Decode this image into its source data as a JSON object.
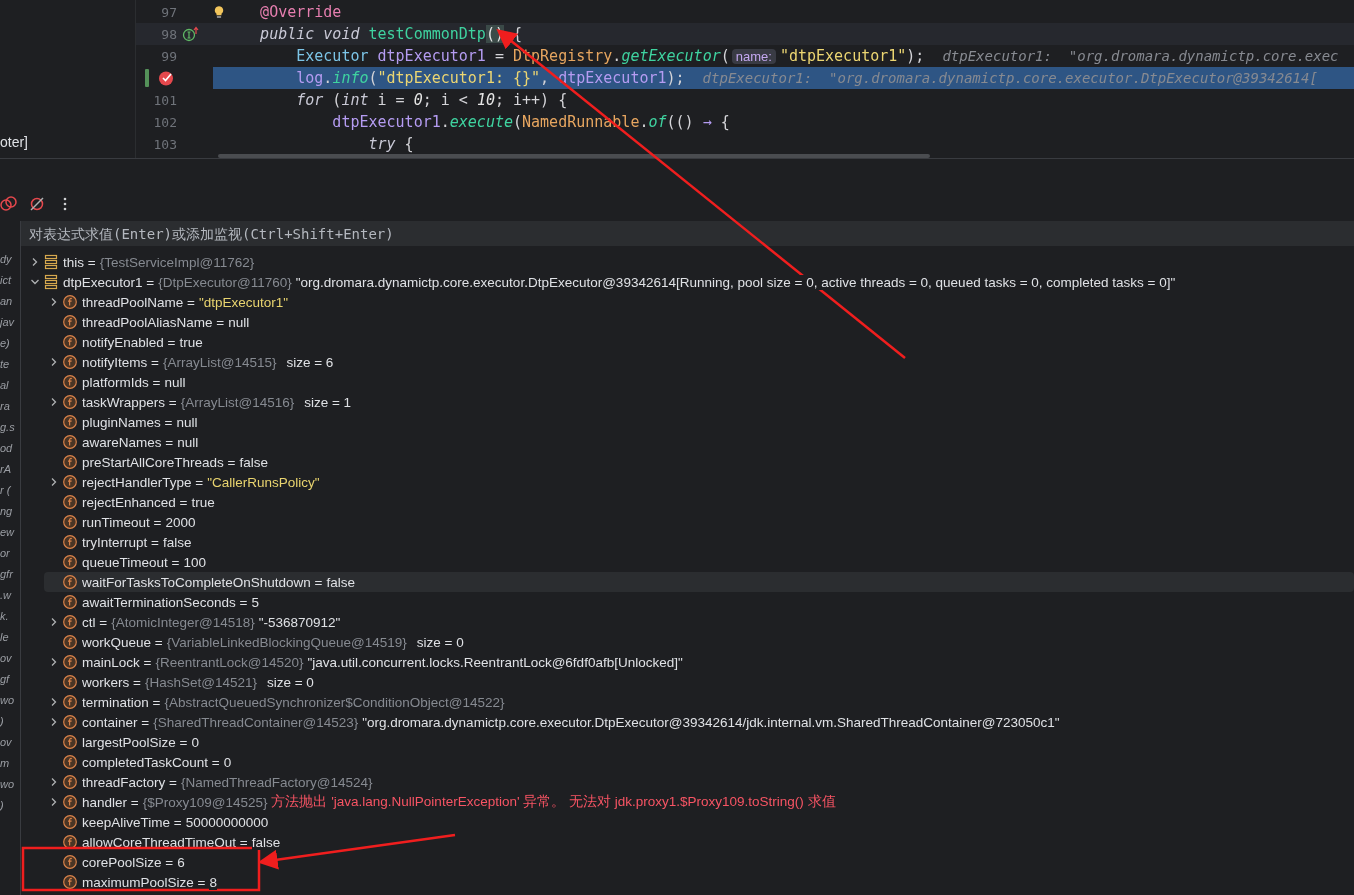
{
  "project_panel": {
    "text": "oter]"
  },
  "editor": {
    "lines": [
      {
        "number": "97",
        "current": false,
        "selected": false,
        "bulb": true,
        "tokens": [
          {
            "text": "    @Override",
            "kind": "ann"
          }
        ]
      },
      {
        "number": "98",
        "current": true,
        "selected": false,
        "implements_marker": true,
        "tokens": [
          {
            "text": "    public void ",
            "kind": "kw"
          },
          {
            "text": "testCommonDtp",
            "kind": "decl"
          },
          {
            "text": "()",
            "kind": "brace"
          },
          {
            "text": " {",
            "kind": "plain"
          }
        ]
      },
      {
        "number": "99",
        "current": false,
        "selected": false,
        "tokens": [
          {
            "text": "        Executor ",
            "kind": "type"
          },
          {
            "text": "dtpExecutor1",
            "kind": "var"
          },
          {
            "text": " = ",
            "kind": "plain"
          },
          {
            "text": "DtpRegistry",
            "kind": "cls"
          },
          {
            "text": ".",
            "kind": "plain"
          },
          {
            "text": "getExecutor",
            "kind": "call"
          },
          {
            "text": "(",
            "kind": "plain"
          },
          {
            "text": "name:",
            "kind": "hint"
          },
          {
            "text": "\"dtpExecutor1\"",
            "kind": "str"
          },
          {
            "text": ");",
            "kind": "plain"
          },
          {
            "text": "dtpExecutor1:  \"org.dromara.dynamictp.core.exec",
            "kind": "inline"
          }
        ]
      },
      {
        "current": false,
        "selected": true,
        "breakpoint": true,
        "changed": true,
        "tokens": [
          {
            "text": "        log",
            "kind": "var"
          },
          {
            "text": ".",
            "kind": "plain"
          },
          {
            "text": "info",
            "kind": "call"
          },
          {
            "text": "(",
            "kind": "plain"
          },
          {
            "text": "\"dtpExecutor1: {}\"",
            "kind": "str"
          },
          {
            "text": ", ",
            "kind": "plain"
          },
          {
            "text": "dtpExecutor1",
            "kind": "var"
          },
          {
            "text": ");",
            "kind": "plain"
          },
          {
            "text": "dtpExecutor1:  \"org.dromara.dynamictp.core.executor.DtpExecutor@39342614[",
            "kind": "inline"
          }
        ]
      },
      {
        "number": "101",
        "current": false,
        "selected": false,
        "tokens": [
          {
            "text": "        for",
            "kind": "kw"
          },
          {
            "text": " (",
            "kind": "plain"
          },
          {
            "text": "int",
            "kind": "kw"
          },
          {
            "text": " i = ",
            "kind": "plain"
          },
          {
            "text": "0",
            "kind": "num"
          },
          {
            "text": "; i < ",
            "kind": "plain"
          },
          {
            "text": "10",
            "kind": "num"
          },
          {
            "text": "; i++) {",
            "kind": "plain"
          }
        ]
      },
      {
        "number": "102",
        "current": false,
        "selected": false,
        "tokens": [
          {
            "text": "            dtpExecutor1",
            "kind": "var"
          },
          {
            "text": ".",
            "kind": "plain"
          },
          {
            "text": "execute",
            "kind": "call"
          },
          {
            "text": "(",
            "kind": "plain"
          },
          {
            "text": "NamedRunnable",
            "kind": "cls"
          },
          {
            "text": ".",
            "kind": "plain"
          },
          {
            "text": "of",
            "kind": "call"
          },
          {
            "text": "(() ",
            "kind": "plain"
          },
          {
            "text": "→",
            "kind": "arrow"
          },
          {
            "text": " {",
            "kind": "plain"
          }
        ]
      },
      {
        "number": "103",
        "current": false,
        "selected": false,
        "tokens": [
          {
            "text": "                try",
            "kind": "kw"
          },
          {
            "text": " {",
            "kind": "plain"
          }
        ]
      }
    ]
  },
  "evaluate": {
    "placeholder": "对表达式求值(Enter)或添加监视(Ctrl+Shift+Enter)"
  },
  "frames": [
    {
      "text": "dy"
    },
    {
      "text": "ict"
    },
    {
      "text": "an"
    },
    {
      "text": "jav"
    },
    {
      "text": "e)"
    },
    {
      "text": "te"
    },
    {
      "text": "al"
    },
    {
      "text": "ra"
    },
    {
      "text": "g.s"
    },
    {
      "text": "od"
    },
    {
      "text": "rA"
    },
    {
      "text": "r ("
    },
    {
      "text": "ng"
    },
    {
      "text": "ew"
    },
    {
      "text": "or"
    },
    {
      "text": "gfr"
    },
    {
      "text": ".w"
    },
    {
      "text": "k."
    },
    {
      "text": "le"
    },
    {
      "text": "ov"
    },
    {
      "text": "gf"
    },
    {
      "text": "wo"
    },
    {
      "text": ")"
    },
    {
      "text": "ov"
    },
    {
      "text": "m"
    },
    {
      "text": "wo"
    },
    {
      "text": ")"
    }
  ],
  "variables": [
    {
      "kind": "local",
      "name": "this =",
      "ref": "{TestServiceImpl@11762}",
      "expandable": true,
      "expanded": false,
      "selected": false
    },
    {
      "kind": "local",
      "name": "dtpExecutor1 =",
      "ref": "{DtpExecutor@11760}",
      "value": "\"org.dromara.dynamictp.core.executor.DtpExecutor@39342614[Running, pool size = 0, active threads = 0, queued tasks = 0, completed tasks = 0]\"",
      "expandable": true,
      "expanded": true,
      "selected": false,
      "children": [
        {
          "kind": "field",
          "name": "threadPoolName =",
          "value": "\"dtpExecutor1\"",
          "string_value": true,
          "expandable": true,
          "selected": false
        },
        {
          "kind": "field",
          "name": "threadPoolAliasName =",
          "value": "null",
          "selected": false
        },
        {
          "kind": "field",
          "name": "notifyEnabled =",
          "value": "true",
          "selected": false
        },
        {
          "kind": "field",
          "name": "notifyItems =",
          "ref": "{ArrayList@14515}",
          "size": "size = 6",
          "expandable": true,
          "selected": false
        },
        {
          "kind": "field",
          "name": "platformIds =",
          "value": "null",
          "selected": false
        },
        {
          "kind": "field",
          "name": "taskWrappers =",
          "ref": "{ArrayList@14516}",
          "size": "size = 1",
          "expandable": true,
          "selected": false
        },
        {
          "kind": "field",
          "name": "pluginNames =",
          "value": "null",
          "selected": false
        },
        {
          "kind": "field",
          "name": "awareNames =",
          "value": "null",
          "selected": false
        },
        {
          "kind": "field",
          "name": "preStartAllCoreThreads =",
          "value": "false",
          "selected": false
        },
        {
          "kind": "field",
          "name": "rejectHandlerType =",
          "value": "\"CallerRunsPolicy\"",
          "string_value": true,
          "expandable": true,
          "selected": false
        },
        {
          "kind": "field",
          "name": "rejectEnhanced =",
          "value": "true",
          "selected": false
        },
        {
          "kind": "field",
          "name": "runTimeout =",
          "value": "2000",
          "selected": false
        },
        {
          "kind": "field",
          "name": "tryInterrupt =",
          "value": "false",
          "selected": false
        },
        {
          "kind": "field",
          "name": "queueTimeout =",
          "value": "100",
          "selected": false
        },
        {
          "kind": "field",
          "name": "waitForTasksToCompleteOnShutdown =",
          "value": "false",
          "selected": true
        },
        {
          "kind": "field",
          "name": "awaitTerminationSeconds =",
          "value": "5",
          "selected": false
        },
        {
          "kind": "field",
          "name": "ctl =",
          "ref": "{AtomicInteger@14518}",
          "value": "\"-536870912\"",
          "expandable": true,
          "selected": false
        },
        {
          "kind": "field",
          "name": "workQueue =",
          "ref": "{VariableLinkedBlockingQueue@14519}",
          "size": "size = 0",
          "selected": false
        },
        {
          "kind": "field",
          "name": "mainLock =",
          "ref": "{ReentrantLock@14520}",
          "value": "\"java.util.concurrent.locks.ReentrantLock@6fdf0afb[Unlocked]\"",
          "expandable": true,
          "selected": false
        },
        {
          "kind": "field",
          "name": "workers =",
          "ref": "{HashSet@14521}",
          "size": "size = 0",
          "selected": false
        },
        {
          "kind": "field",
          "name": "termination =",
          "ref": "{AbstractQueuedSynchronizer$ConditionObject@14522}",
          "expandable": true,
          "selected": false
        },
        {
          "kind": "field",
          "name": "container =",
          "ref": "{SharedThreadContainer@14523}",
          "value": "\"org.dromara.dynamictp.core.executor.DtpExecutor@39342614/jdk.internal.vm.SharedThreadContainer@723050c1\"",
          "expandable": true,
          "selected": false
        },
        {
          "kind": "field",
          "name": "largestPoolSize =",
          "value": "0",
          "selected": false
        },
        {
          "kind": "field",
          "name": "completedTaskCount =",
          "value": "0",
          "selected": false
        },
        {
          "kind": "field",
          "name": "threadFactory =",
          "ref": "{NamedThreadFactory@14524}",
          "expandable": true,
          "selected": false
        },
        {
          "kind": "field",
          "name": "handler =",
          "ref": "{$Proxy109@14525}",
          "value": "方法抛出 'java.lang.NullPointerException' 异常。 无法对 jdk.proxy1.$Proxy109.toString() 求值",
          "error": true,
          "expandable": true,
          "selected": false
        },
        {
          "kind": "field",
          "name": "keepAliveTime =",
          "value": "50000000000",
          "selected": false
        },
        {
          "kind": "field",
          "name": "allowCoreThreadTimeOut =",
          "value": "false",
          "selected": false
        },
        {
          "kind": "field",
          "name": "corePoolSize =",
          "value": "6",
          "selected": false
        },
        {
          "kind": "field",
          "name": "maximumPoolSize =",
          "value": "8",
          "selected": false
        }
      ]
    }
  ]
}
